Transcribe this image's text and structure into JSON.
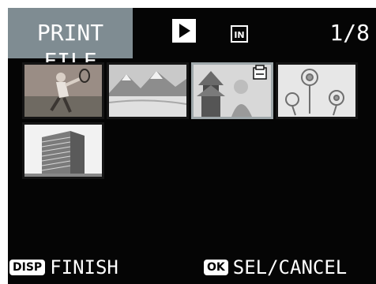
{
  "header": {
    "title": "PRINT FILE",
    "play_icon": "play-icon",
    "memory_icon": "internal-memory-icon",
    "memory_label": "IN",
    "counter": "1/8"
  },
  "thumbnails": [
    {
      "name": "thumb-tennis-player",
      "selected": false
    },
    {
      "name": "thumb-mountain-lake",
      "selected": false
    },
    {
      "name": "thumb-woman-pagoda",
      "selected": true,
      "print_mark": true
    },
    {
      "name": "thumb-flowers",
      "selected": false
    },
    {
      "name": "thumb-building",
      "selected": false
    }
  ],
  "footer": {
    "disp_key": "DISP",
    "disp_label": "FINISH",
    "ok_key": "OK",
    "ok_label": "SEL/CANCEL"
  },
  "colors": {
    "screen_bg": "#050505",
    "title_bg": "#7f8c92",
    "selection_border": "#9ea7aa"
  }
}
